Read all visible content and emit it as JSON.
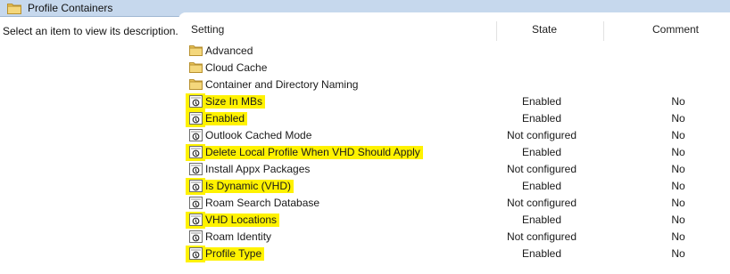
{
  "window": {
    "title": "Profile Containers"
  },
  "description_pane": {
    "text": "Select an item to view its description."
  },
  "columns": {
    "setting": "Setting",
    "state": "State",
    "comment": "Comment"
  },
  "folders": [
    {
      "label": "Advanced"
    },
    {
      "label": "Cloud Cache"
    },
    {
      "label": "Container and Directory Naming"
    }
  ],
  "settings": [
    {
      "label": "Size In MBs",
      "state": "Enabled",
      "comment": "No",
      "highlighted": true
    },
    {
      "label": "Enabled",
      "state": "Enabled",
      "comment": "No",
      "highlighted": true
    },
    {
      "label": "Outlook Cached Mode",
      "state": "Not configured",
      "comment": "No",
      "highlighted": false
    },
    {
      "label": "Delete Local Profile When VHD Should Apply",
      "state": "Enabled",
      "comment": "No",
      "highlighted": true
    },
    {
      "label": "Install Appx Packages",
      "state": "Not configured",
      "comment": "No",
      "highlighted": false
    },
    {
      "label": "Is Dynamic (VHD)",
      "state": "Enabled",
      "comment": "No",
      "highlighted": true
    },
    {
      "label": "Roam Search Database",
      "state": "Not configured",
      "comment": "No",
      "highlighted": false
    },
    {
      "label": "VHD Locations",
      "state": "Enabled",
      "comment": "No",
      "highlighted": true
    },
    {
      "label": "Roam Identity",
      "state": "Not configured",
      "comment": "No",
      "highlighted": false
    },
    {
      "label": "Profile Type",
      "state": "Enabled",
      "comment": "No",
      "highlighted": true
    }
  ],
  "colors": {
    "highlight": "#fff200",
    "titlebar": "#c6d8ed",
    "folder": "#e8c25a"
  },
  "icons": {
    "folder": "folder-icon",
    "setting": "policy-setting-icon"
  }
}
